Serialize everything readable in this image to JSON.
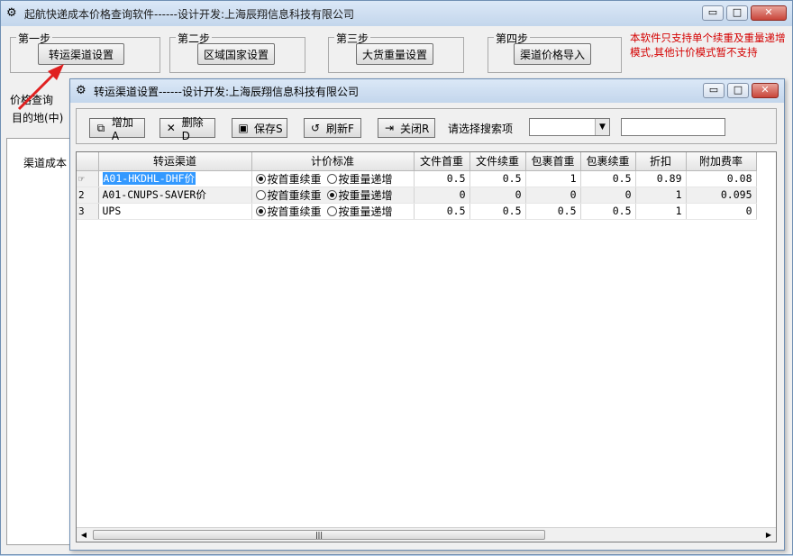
{
  "main": {
    "title": "起航快递成本价格查询软件------设计开发:上海辰翔信息科技有限公司",
    "window_controls": {
      "minimize": "▭",
      "maximize": "□",
      "close": "✕"
    }
  },
  "steps": [
    {
      "label": "第一步",
      "button": "转运渠道设置"
    },
    {
      "label": "第二步",
      "button": "区域国家设置"
    },
    {
      "label": "第三步",
      "button": "大货重量设置"
    },
    {
      "label": "第四步",
      "button": "渠道价格导入"
    }
  ],
  "notice": "本软件只支持单个续重及重量递增模式,其他计价模式暂不支持",
  "query": {
    "group_label": "价格查询",
    "destination_label": "目的地(中)"
  },
  "left_tab": "渠道成本",
  "child": {
    "title": "转运渠道设置------设计开发:上海辰翔信息科技有限公司",
    "toolbar": {
      "add": "增加A",
      "delete": "删除D",
      "save": "保存S",
      "refresh": "刷新F",
      "close": "关闭R",
      "search_label": "请选择搜索项",
      "search_value": ""
    },
    "columns": [
      "转运渠道",
      "计价标准",
      "文件首重",
      "文件续重",
      "包裹首重",
      "包裹续重",
      "折扣",
      "附加费率"
    ],
    "radio_labels": {
      "first_continue": "按首重续重",
      "weight_increase": "按重量递增"
    },
    "rows": [
      {
        "num": "",
        "channel": "A01-HKDHL-DHF价",
        "mode": "first",
        "file_first": "0.5",
        "file_cont": "0.5",
        "parcel_first": "1",
        "parcel_cont": "0.5",
        "discount": "0.89",
        "surcharge": "0.08"
      },
      {
        "num": "2",
        "channel": "A01-CNUPS-SAVER价",
        "mode": "increase",
        "file_first": "0",
        "file_cont": "0",
        "parcel_first": "0",
        "parcel_cont": "0",
        "discount": "1",
        "surcharge": "0.095"
      },
      {
        "num": "3",
        "channel": "UPS",
        "mode": "first",
        "file_first": "0.5",
        "file_cont": "0.5",
        "parcel_first": "0.5",
        "parcel_cont": "0.5",
        "discount": "1",
        "surcharge": "0"
      }
    ]
  },
  "colors": {
    "accent_red": "#d40000",
    "selection": "#3399ff",
    "title_bar": "#c3d6ec"
  }
}
